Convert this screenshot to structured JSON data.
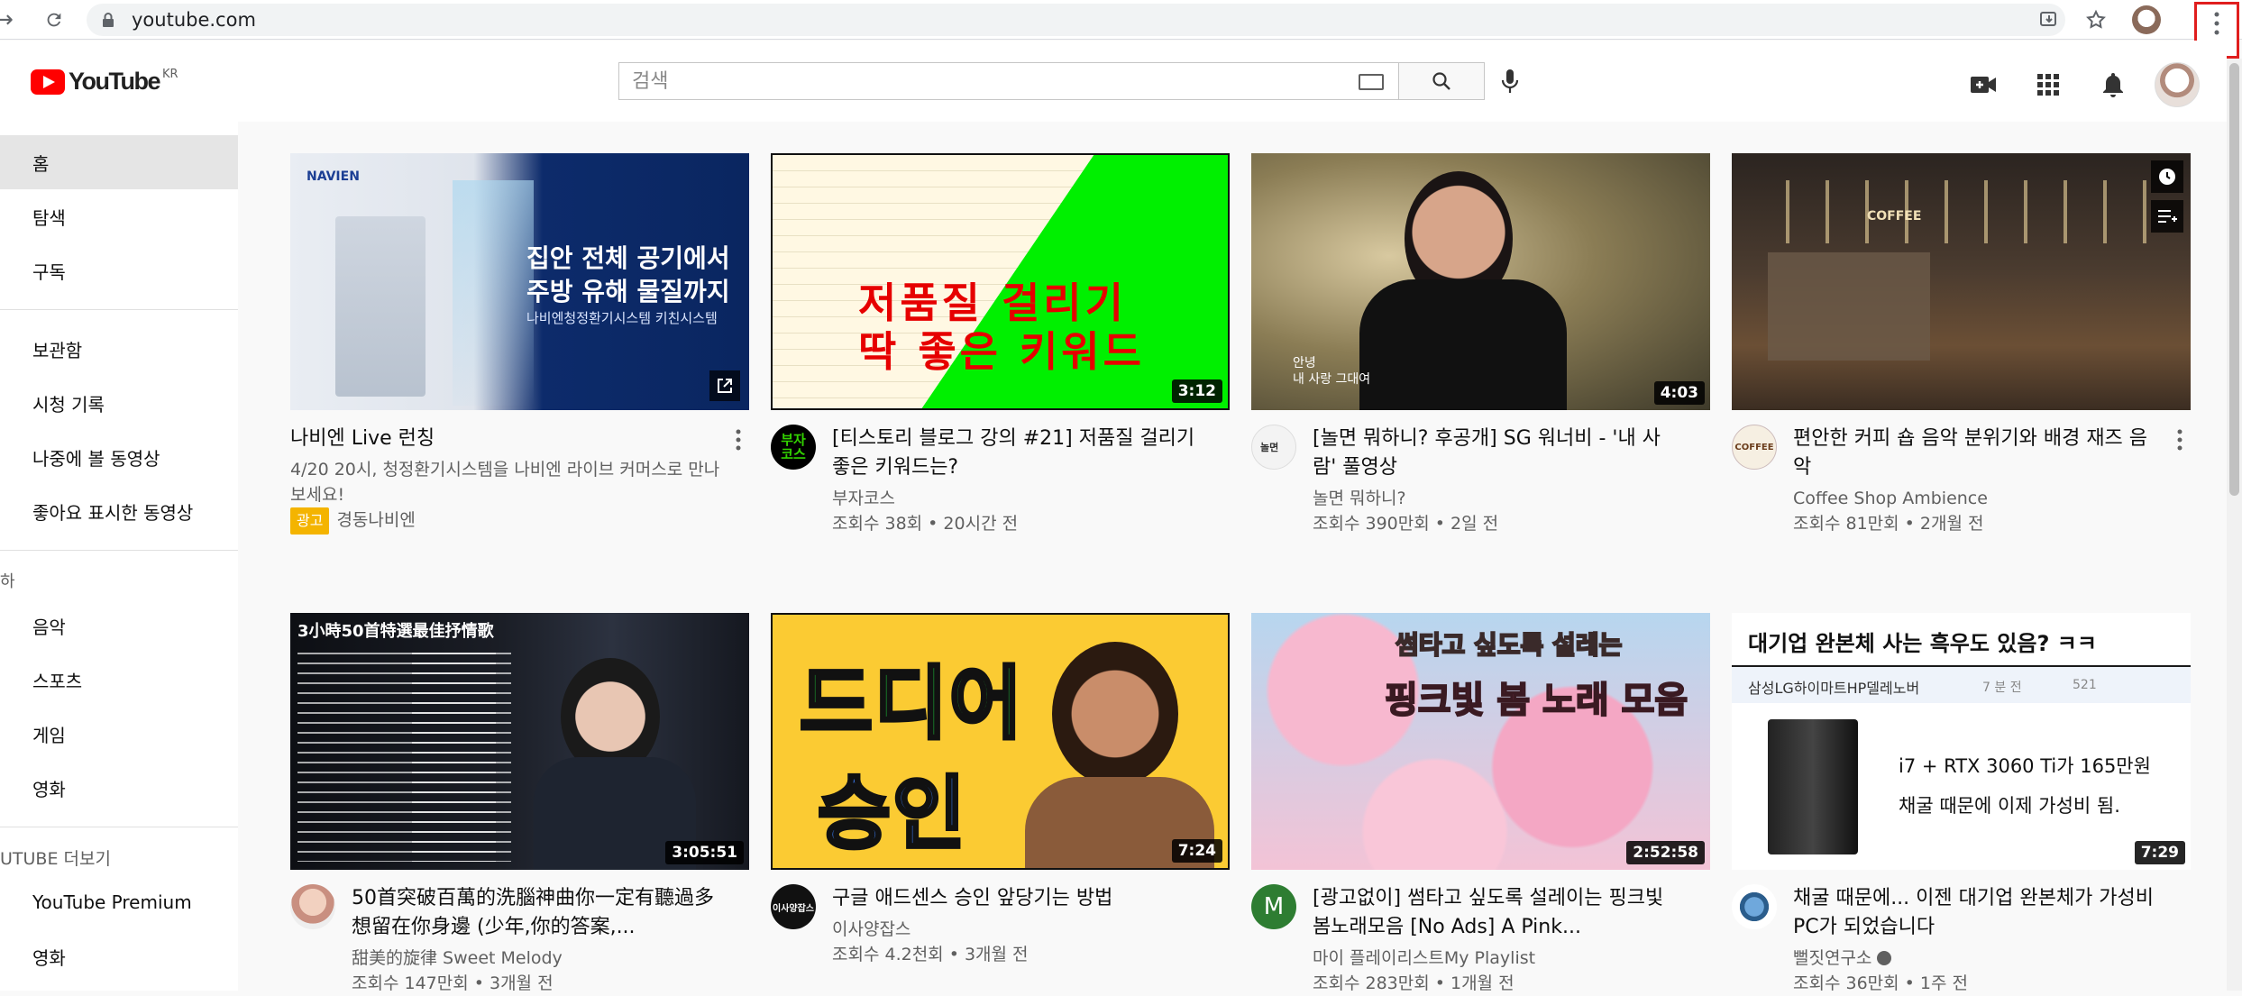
{
  "browser": {
    "url": "youtube.com"
  },
  "header": {
    "logo_text": "YouTube",
    "logo_region": "KR",
    "search_placeholder": "검색"
  },
  "sidebar": {
    "items": [
      {
        "label": "홈",
        "active": true
      },
      {
        "label": "탐색"
      },
      {
        "label": "구독"
      },
      {
        "label": "보관함"
      },
      {
        "label": "시청 기록"
      },
      {
        "label": "나중에 볼 동영상"
      },
      {
        "label": "좋아요 표시한 동영상"
      },
      {
        "label": "음악"
      },
      {
        "label": "스포츠"
      },
      {
        "label": "게임"
      },
      {
        "label": "영화"
      },
      {
        "label": "YouTube Premium"
      },
      {
        "label": "영화"
      }
    ],
    "section_head": "UTUBE 더보기",
    "section_head_top": "하"
  },
  "videos": [
    {
      "title": "나비엔 Live 런칭",
      "desc": "4/20 20시, 청정환기시스템을 나비엔 라이브 커머스로 만나보세요!",
      "ad_label": "광고",
      "channel": "경동나비엔",
      "thumb_text": [
        "NAVIEN",
        "집안 전체 공기에서",
        "주방 유해 물질까지",
        "나비엔청정환기시스템 키친시스템"
      ]
    },
    {
      "title": "[티스토리 블로그 강의 #21] 저품질 걸리기 좋은 키워드는?",
      "channel": "부자코스",
      "stats": "조회수 38회 • 20시간 전",
      "duration": "3:12",
      "avatar_text": "부자코스",
      "thumb_text": [
        "저품질 걸리기",
        "딱 좋은 키워드"
      ]
    },
    {
      "title": "[놀면 뭐하니? 후공개] SG 워너비 - '내 사람' 풀영상",
      "channel": "놀면 뭐하니?",
      "stats": "조회수 390만회 • 2일 전",
      "duration": "4:03",
      "thumb_text": [
        "안녕",
        "내 사랑 그대여"
      ]
    },
    {
      "title": "편안한 커피 숍 음악 분위기와 배경 재즈 음악",
      "channel": "Coffee Shop Ambience",
      "stats": "조회수 81만회 • 2개월 전",
      "thumb_text": [
        "COFFEE"
      ],
      "avatar_text": "COFFEE"
    },
    {
      "title": "50首突破百萬的洗腦神曲你一定有聽過多想留在你身邊 (少年,你的答案,...",
      "channel": "甜美的旋律 Sweet Melody",
      "stats": "조회수 147만회 • 3개월 전",
      "duration": "3:05:51",
      "thumb_text": [
        "3小時50首特選最佳抒情歌"
      ]
    },
    {
      "title": "구글 애드센스 승인 앞당기는 방법",
      "channel": "이사양잡스",
      "stats": "조회수 4.2천회 • 3개월 전",
      "duration": "7:24",
      "avatar_text": "이사양잡스",
      "thumb_text": [
        "드디어",
        "승인"
      ]
    },
    {
      "title": "[광고없이] 썸타고 싶도록 설레이는 핑크빛 봄노래모음 [No Ads] A Pink...",
      "channel": "마이 플레이리스트My Playlist",
      "stats": "조회수 283만회 • 1개월 전",
      "duration": "2:52:58",
      "avatar_text": "M",
      "thumb_text": [
        "썸타고 싶도록 설레는",
        "핑크빛 봄 노래 모음"
      ]
    },
    {
      "title": "채굴 때문에... 이젠 대기업 완본체가 가성비 PC가 되었습니다",
      "channel": "뻘짓연구소",
      "stats": "조회수 36만회 • 1주 전",
      "duration": "7:29",
      "thumb_text": [
        "대기업 완본체 사는 흑우도 있음? ㅋㅋ",
        "삼성LG하이마트HP델레노버",
        "7 분 전",
        "521",
        "i7 + RTX 3060 Ti가 165만원",
        "채굴 때문에 이제 가성비 됨."
      ]
    }
  ]
}
